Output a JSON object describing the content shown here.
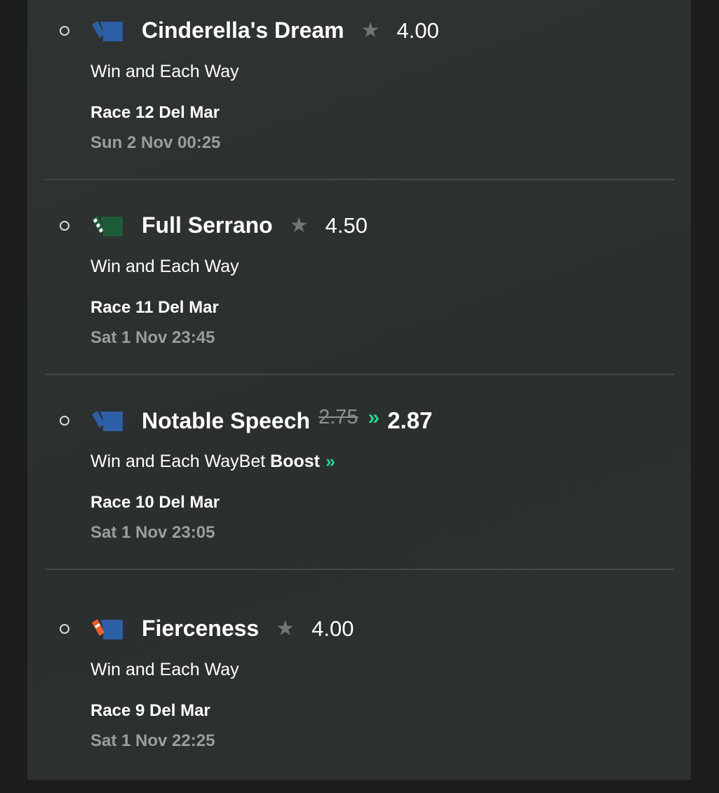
{
  "bets": [
    {
      "runner": "Cinderella's Dream",
      "odds": "4.00",
      "market": "Win and Each Way",
      "race": "Race 12 Del Mar",
      "time": "Sun 2 Nov 00:25",
      "silk_icon": "jockey-silk-blue-icon",
      "colors": {
        "body": "#2d5fa6",
        "sleeve": "#2d5fa6"
      }
    },
    {
      "runner": "Full Serrano",
      "odds": "4.50",
      "market": "Win and Each Way",
      "race": "Race 11 Del Mar",
      "time": "Sat 1 Nov 23:45",
      "silk_icon": "jockey-silk-green-icon",
      "colors": {
        "body": "#1e5b3a",
        "sleeve": "#ffffff"
      }
    },
    {
      "runner": "Notable Speech",
      "old_odds": "2.75",
      "boosted_odds": "2.87",
      "market": "Win and Each Way",
      "boost_prefix": "Bet ",
      "boost_label": "Boost",
      "boost_arrows": "»",
      "race": "Race 10 Del Mar",
      "time": "Sat 1 Nov 23:05",
      "silk_icon": "jockey-silk-blue-icon",
      "colors": {
        "body": "#2d5fa6",
        "sleeve": "#2d5fa6",
        "boost": "#28d48e"
      }
    },
    {
      "runner": "Fierceness",
      "odds": "4.00",
      "market": "Win and Each Way",
      "race": "Race 9 Del Mar",
      "time": "Sat 1 Nov 22:25",
      "silk_icon": "jockey-silk-blue-orange-icon",
      "colors": {
        "body": "#2d5fa6",
        "sleeve": "#e8622c"
      }
    }
  ]
}
